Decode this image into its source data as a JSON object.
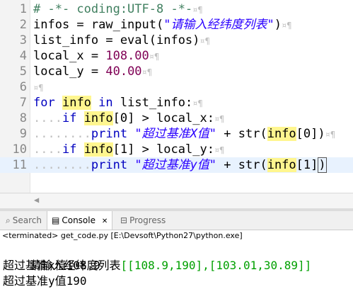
{
  "editor": {
    "line_numbers": [
      "1",
      "2",
      "3",
      "4",
      "5",
      "6",
      "7",
      "8",
      "9",
      "10",
      "11"
    ],
    "line1": {
      "text": "# -*- coding:UTF-8 -*-"
    },
    "line2": {
      "a": "infos = raw_input(",
      "s": "\"请输入经纬度列表\"",
      "b": ")"
    },
    "line3": {
      "text": "list_info = eval(infos)"
    },
    "line4": {
      "a": "local_x = ",
      "n": "108.00"
    },
    "line5": {
      "a": "local_y = ",
      "n": "40.00"
    },
    "line7": {
      "kw": "for",
      "v1": "info",
      "kw2": "in",
      "rest": "list_info:"
    },
    "line8": {
      "kw": "if",
      "v": "info",
      "idx": "[0]",
      "rest": " > local_x:"
    },
    "line9": {
      "kw": "print",
      "s": "\"超过基准X值\"",
      "rest": " + str(",
      "v": "info",
      "idx": "[0])"
    },
    "line10": {
      "kw": "if",
      "v": "info",
      "idx": "[1]",
      "rest": " > local_y:"
    },
    "line11": {
      "kw": "print",
      "s": "\"超过基准y值\"",
      "rest": " + str(",
      "v": "info",
      "idx": "[1]",
      "close": ")"
    }
  },
  "panel": {
    "tabs": [
      {
        "label": "Search",
        "icon": "search-icon"
      },
      {
        "label": "Console",
        "icon": "console-icon",
        "close": "✕"
      },
      {
        "label": "Progress",
        "icon": "progress-icon"
      }
    ],
    "status": "<terminated> get_code.py [E:\\Devsoft\\Python27\\python.exe]"
  },
  "console": {
    "prompt": "请输入经纬度列表",
    "input": "[[108.9,190],[103.01,30.89]]",
    "out1": "超过基准x值108.9",
    "out2": "超过基准y值190"
  },
  "colors": {
    "keyword": "#0000c0",
    "string": "#2a00ff",
    "comment": "#3f7f5f",
    "number": "#7f0055",
    "console_input": "#00a000",
    "highlight": "#fff68f"
  }
}
